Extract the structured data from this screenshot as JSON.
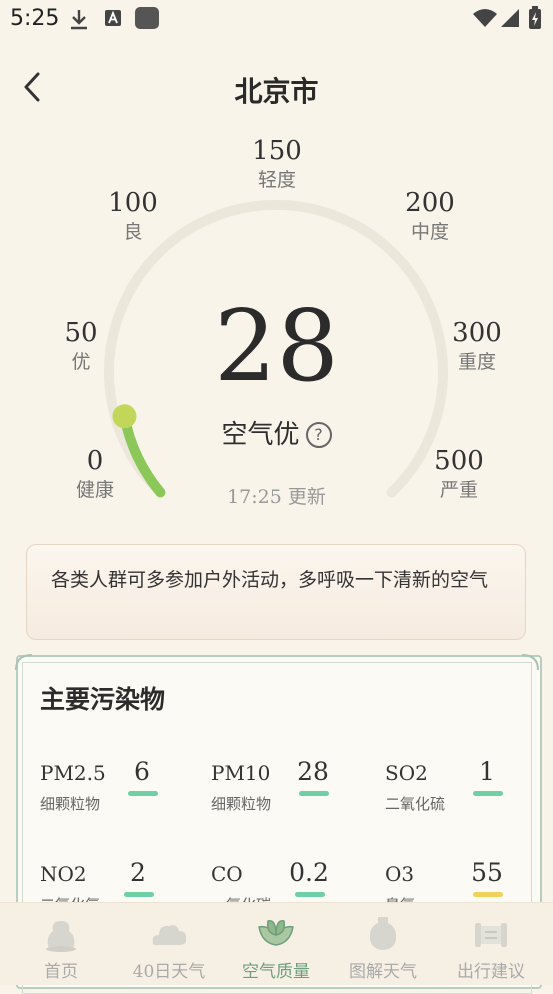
{
  "status_bar": {
    "time": "5:25"
  },
  "header": {
    "title": "北京市"
  },
  "gauge": {
    "labels": [
      {
        "value": "0",
        "text": "健康"
      },
      {
        "value": "50",
        "text": "优"
      },
      {
        "value": "100",
        "text": "良"
      },
      {
        "value": "150",
        "text": "轻度"
      },
      {
        "value": "200",
        "text": "中度"
      },
      {
        "value": "300",
        "text": "重度"
      },
      {
        "value": "500",
        "text": "严重"
      }
    ],
    "aqi": "28",
    "aqi_level": "空气优",
    "help": "?",
    "update_time": "17:25 更新",
    "progress_color": "#8cc75a"
  },
  "advice": "各类人群可多参加户外活动，多呼吸一下清新的空气",
  "pollutants": {
    "title": "主要污染物",
    "items": [
      {
        "name": "PM2.5",
        "desc": "细颗粒物",
        "value": "6",
        "color": "green"
      },
      {
        "name": "PM10",
        "desc": "细颗粒物",
        "value": "28",
        "color": "green"
      },
      {
        "name": "SO2",
        "desc": "二氧化硫",
        "value": "1",
        "color": "green"
      },
      {
        "name": "NO2",
        "desc": "二氧化氮",
        "value": "2",
        "color": "green"
      },
      {
        "name": "CO",
        "desc": "一氧化碳",
        "value": "0.2",
        "color": "green"
      },
      {
        "name": "O3",
        "desc": "臭氧",
        "value": "55",
        "color": "yellow"
      }
    ]
  },
  "nav": {
    "tabs": [
      {
        "label": "首页",
        "icon": "home-icon"
      },
      {
        "label": "40日天气",
        "icon": "cloud-icon"
      },
      {
        "label": "空气质量",
        "icon": "leaf-icon"
      },
      {
        "label": "图解天气",
        "icon": "vase-icon"
      },
      {
        "label": "出行建议",
        "icon": "scroll-icon"
      }
    ],
    "active_index": 2
  }
}
